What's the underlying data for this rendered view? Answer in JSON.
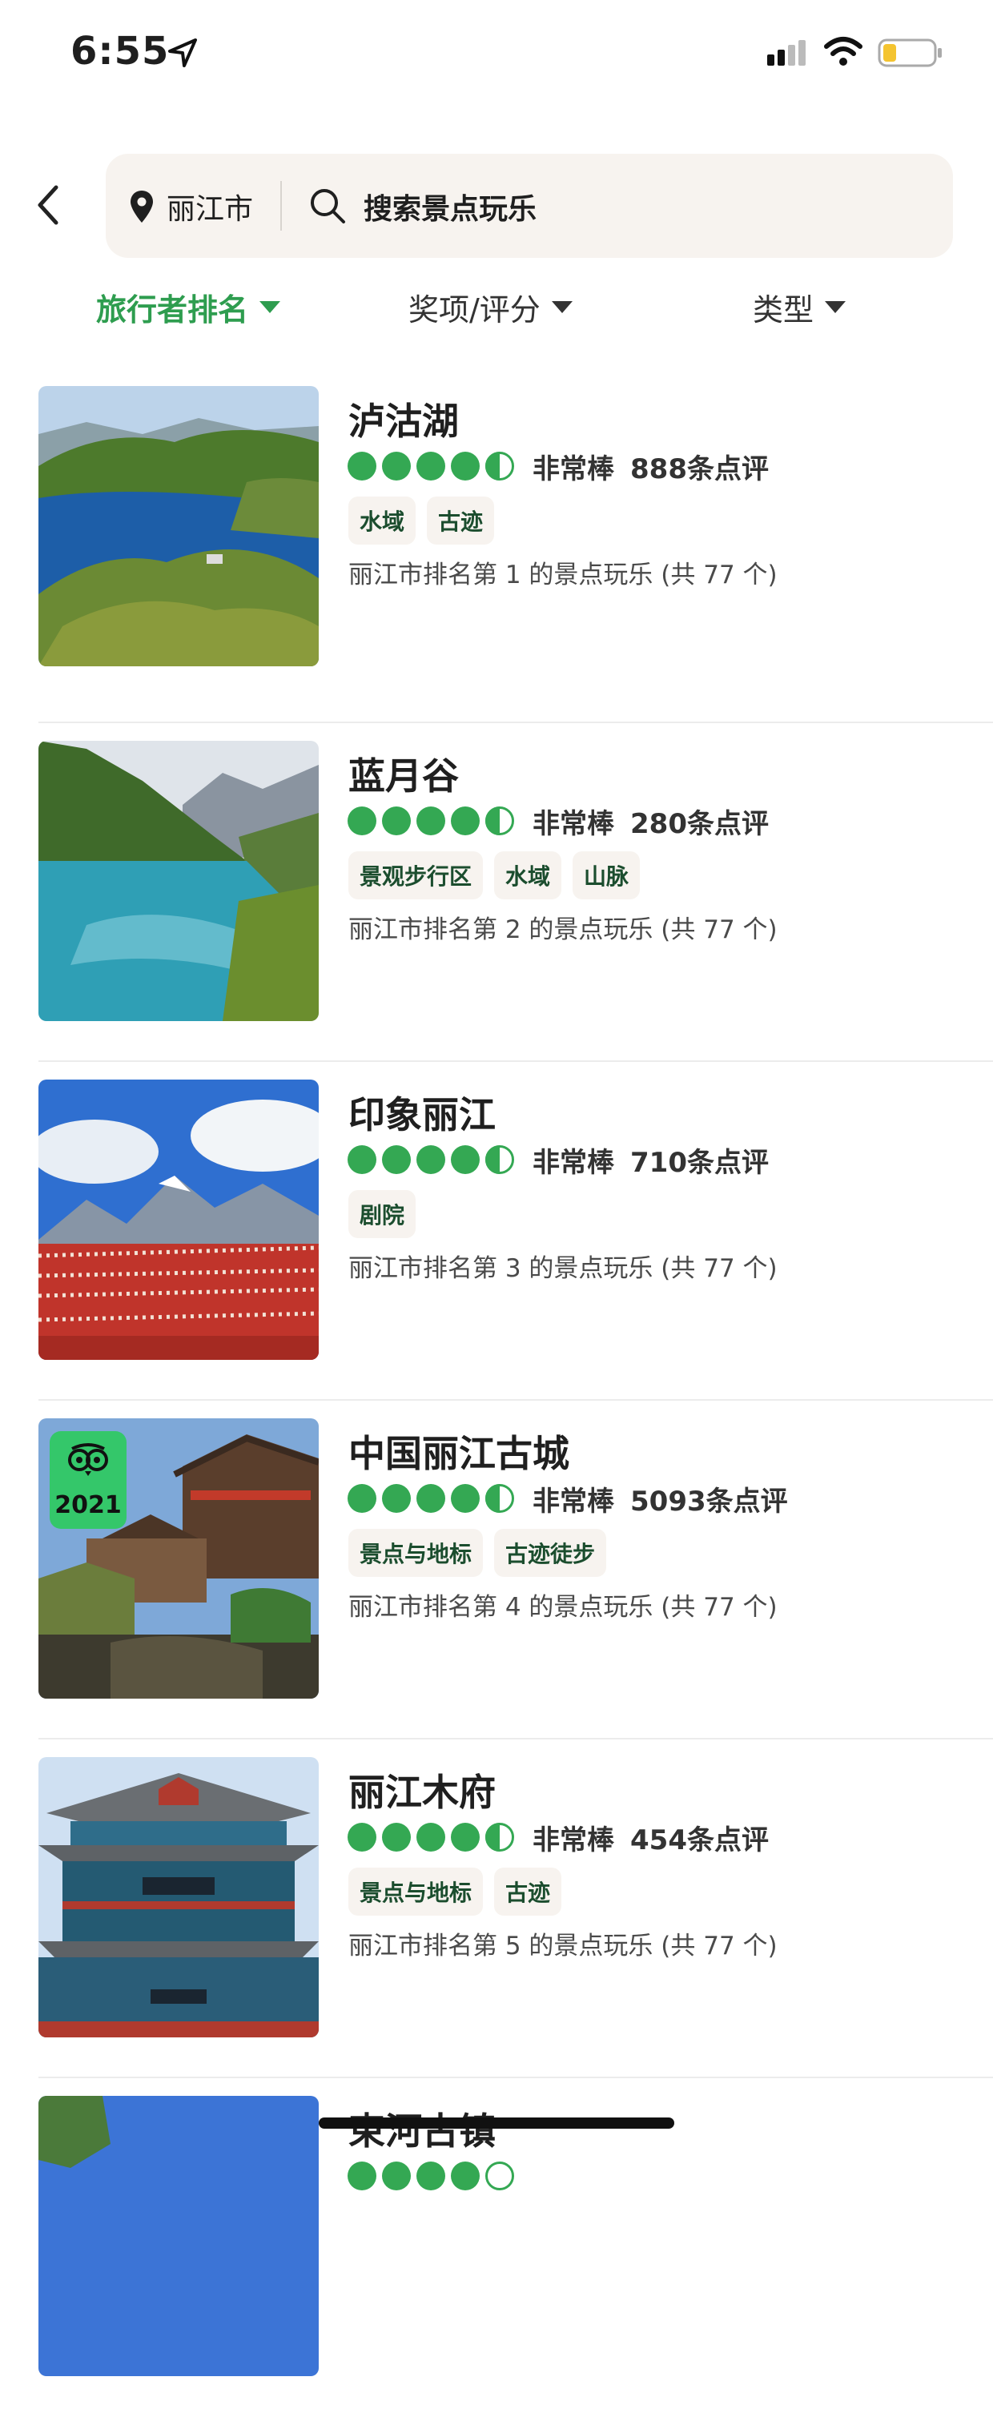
{
  "status_bar": {
    "time": "6:55"
  },
  "search": {
    "city": "丽江市",
    "placeholder": "搜索景点玩乐"
  },
  "filters": [
    {
      "label": "旅行者排名",
      "active": true
    },
    {
      "label": "奖项/评分",
      "active": false
    },
    {
      "label": "类型",
      "active": false
    }
  ],
  "colors": {
    "accent": "#2e9d4f",
    "bubble": "#34a853",
    "tag_bg": "#f7f3ef"
  },
  "items": [
    {
      "title": "泸沽湖",
      "rating": 4.5,
      "rating_text": "非常棒",
      "reviews": "888条点评",
      "tags": [
        "水域",
        "古迹"
      ],
      "rank": "丽江市排名第 1 的景点玩乐 (共 77 个)"
    },
    {
      "title": "蓝月谷",
      "rating": 4.5,
      "rating_text": "非常棒",
      "reviews": "280条点评",
      "tags": [
        "景观步行区",
        "水域",
        "山脉"
      ],
      "rank": "丽江市排名第 2 的景点玩乐 (共 77 个)"
    },
    {
      "title": "印象丽江",
      "rating": 4.5,
      "rating_text": "非常棒",
      "reviews": "710条点评",
      "tags": [
        "剧院"
      ],
      "rank": "丽江市排名第 3 的景点玩乐 (共 77 个)"
    },
    {
      "title": "中国丽江古城",
      "rating": 4.5,
      "rating_text": "非常棒",
      "reviews": "5093条点评",
      "tags": [
        "景点与地标",
        "古迹徒步"
      ],
      "rank": "丽江市排名第 4 的景点玩乐 (共 77 个)",
      "award_year": "2021"
    },
    {
      "title": "丽江木府",
      "rating": 4.5,
      "rating_text": "非常棒",
      "reviews": "454条点评",
      "tags": [
        "景点与地标",
        "古迹"
      ],
      "rank": "丽江市排名第 5 的景点玩乐 (共 77 个)"
    },
    {
      "title": "束河古镇",
      "rating": 4.5,
      "rating_text": "",
      "reviews": "",
      "tags": [],
      "rank": ""
    }
  ]
}
